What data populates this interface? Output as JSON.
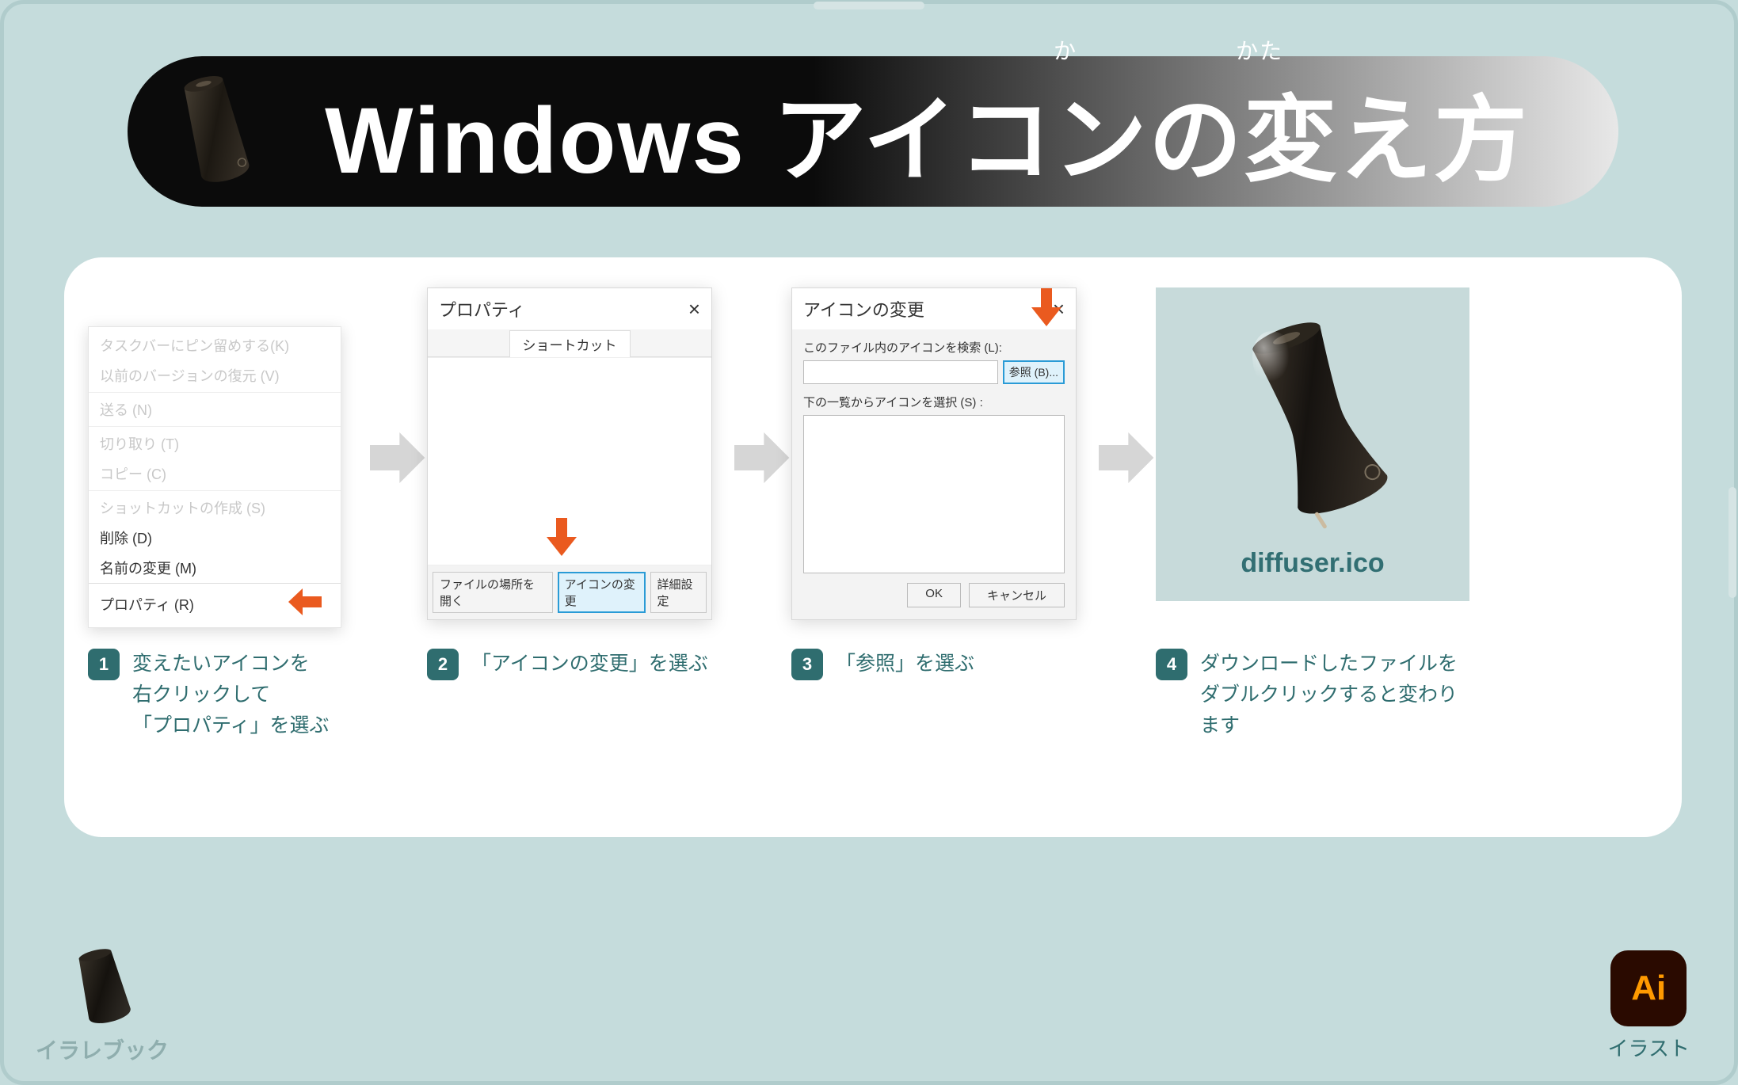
{
  "title": {
    "main": "Windows アイコンの変え方",
    "ruby_ka": "か",
    "ruby_kata": "かた"
  },
  "edge_tabs": true,
  "steps": [
    {
      "num": "1",
      "caption_lines": [
        "変えたいアイコンを",
        "右クリックして",
        "「プロパティ」を選ぶ"
      ],
      "context_menu": {
        "items_faded": [
          "タスクバーにピン留めする(K)",
          "以前のバージョンの復元 (V)",
          "送る (N)",
          "切り取り (T)",
          "コピー (C)",
          "ショットカットの作成 (S)",
          "削除 (D)",
          "名前の変更 (M)"
        ],
        "item_highlight": "プロパティ (R)"
      }
    },
    {
      "num": "2",
      "caption_lines": [
        "「アイコンの変更」を選ぶ"
      ],
      "dialog": {
        "title": "プロパティ",
        "tab": "ショートカット",
        "buttons": [
          "ファイルの場所を開く",
          "アイコンの変更",
          "詳細設定"
        ],
        "highlight_index": 1
      }
    },
    {
      "num": "3",
      "caption_lines": [
        "「参照」を選ぶ"
      ],
      "dialog": {
        "title": "アイコンの変更",
        "hint1": "このファイル内のアイコンを検索 (L):",
        "browse": "参照 (B)...",
        "hint2": "下の一覧からアイコンを選択 (S) :",
        "ok": "OK",
        "cancel": "キャンセル"
      }
    },
    {
      "num": "4",
      "caption_lines": [
        "ダウンロードしたファイルを",
        "ダブルクリックすると変わります"
      ],
      "filename": "diffuser.ico"
    }
  ],
  "footer": {
    "left": "イラレブック",
    "right_badge": "Ai",
    "right_label": "イラスト"
  }
}
